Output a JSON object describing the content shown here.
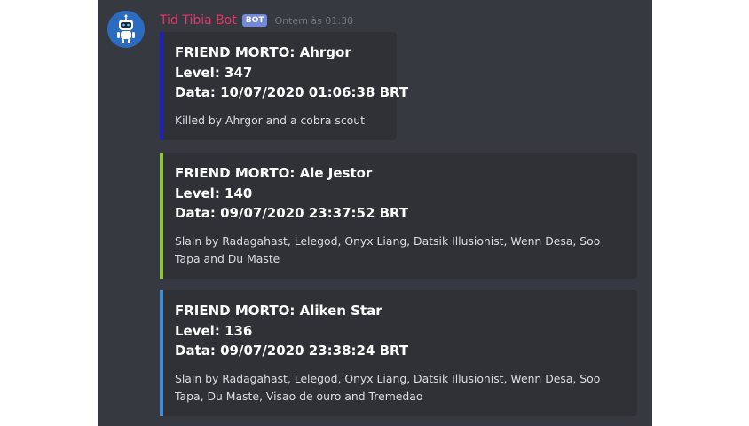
{
  "message": {
    "username": "Tid Tibia Bot",
    "bot_tag": "BOT",
    "timestamp": "Ontem às 01:30"
  },
  "embeds": [
    {
      "accent_color": "#1d1fc4",
      "lines": [
        "FRIEND MORTO: Ahrgor",
        "Level: 347",
        "Data: 10/07/2020 01:06:38 BRT"
      ],
      "description": "Killed by Ahrgor and a cobra scout"
    },
    {
      "accent_color": "#94c53c",
      "lines": [
        "FRIEND MORTO: Ale Jestor",
        "Level: 140",
        "Data: 09/07/2020 23:37:52 BRT"
      ],
      "description": "Slain by Radagahast, Lelegod, Onyx Liang, Datsik Illusionist, Wenn Desa, Soo Tapa and Du Maste"
    },
    {
      "accent_color": "#3f8ed8",
      "lines": [
        "FRIEND MORTO: Aliken Star",
        "Level: 136",
        "Data: 09/07/2020 23:38:24 BRT"
      ],
      "description": "Slain by Radagahast, Lelegod, Onyx Liang, Datsik Illusionist, Wenn Desa, Soo Tapa, Du Maste, Visao de ouro and Tremedao"
    }
  ]
}
